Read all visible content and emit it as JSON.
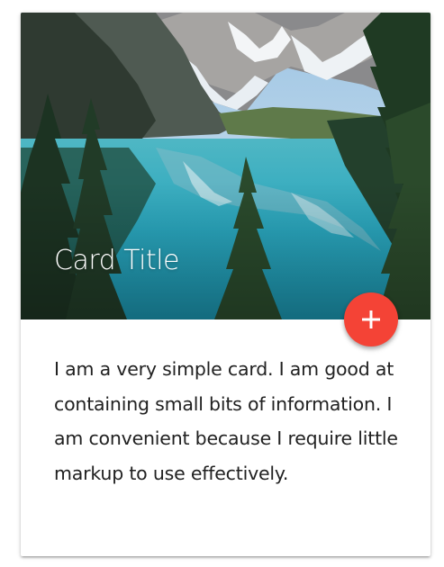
{
  "card": {
    "title": "Card Title",
    "body": "I am a very simple card. I am good at containing small bits of information. I am convenient because I require little markup to use effectively.",
    "image_subject": "mountain lake with evergreen trees",
    "fab_icon": "plus-icon",
    "fab_color": "#f44336"
  }
}
